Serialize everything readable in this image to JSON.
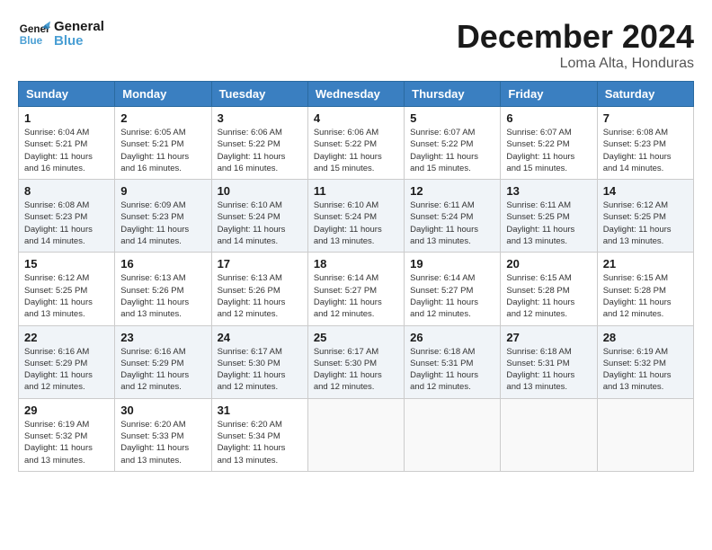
{
  "header": {
    "logo_line1": "General",
    "logo_line2": "Blue",
    "month_title": "December 2024",
    "location": "Loma Alta, Honduras"
  },
  "days_of_week": [
    "Sunday",
    "Monday",
    "Tuesday",
    "Wednesday",
    "Thursday",
    "Friday",
    "Saturday"
  ],
  "weeks": [
    [
      {
        "num": "1",
        "sunrise": "6:04 AM",
        "sunset": "5:21 PM",
        "daylight": "11 hours and 16 minutes."
      },
      {
        "num": "2",
        "sunrise": "6:05 AM",
        "sunset": "5:21 PM",
        "daylight": "11 hours and 16 minutes."
      },
      {
        "num": "3",
        "sunrise": "6:06 AM",
        "sunset": "5:22 PM",
        "daylight": "11 hours and 16 minutes."
      },
      {
        "num": "4",
        "sunrise": "6:06 AM",
        "sunset": "5:22 PM",
        "daylight": "11 hours and 15 minutes."
      },
      {
        "num": "5",
        "sunrise": "6:07 AM",
        "sunset": "5:22 PM",
        "daylight": "11 hours and 15 minutes."
      },
      {
        "num": "6",
        "sunrise": "6:07 AM",
        "sunset": "5:22 PM",
        "daylight": "11 hours and 15 minutes."
      },
      {
        "num": "7",
        "sunrise": "6:08 AM",
        "sunset": "5:23 PM",
        "daylight": "11 hours and 14 minutes."
      }
    ],
    [
      {
        "num": "8",
        "sunrise": "6:08 AM",
        "sunset": "5:23 PM",
        "daylight": "11 hours and 14 minutes."
      },
      {
        "num": "9",
        "sunrise": "6:09 AM",
        "sunset": "5:23 PM",
        "daylight": "11 hours and 14 minutes."
      },
      {
        "num": "10",
        "sunrise": "6:10 AM",
        "sunset": "5:24 PM",
        "daylight": "11 hours and 14 minutes."
      },
      {
        "num": "11",
        "sunrise": "6:10 AM",
        "sunset": "5:24 PM",
        "daylight": "11 hours and 13 minutes."
      },
      {
        "num": "12",
        "sunrise": "6:11 AM",
        "sunset": "5:24 PM",
        "daylight": "11 hours and 13 minutes."
      },
      {
        "num": "13",
        "sunrise": "6:11 AM",
        "sunset": "5:25 PM",
        "daylight": "11 hours and 13 minutes."
      },
      {
        "num": "14",
        "sunrise": "6:12 AM",
        "sunset": "5:25 PM",
        "daylight": "11 hours and 13 minutes."
      }
    ],
    [
      {
        "num": "15",
        "sunrise": "6:12 AM",
        "sunset": "5:25 PM",
        "daylight": "11 hours and 13 minutes."
      },
      {
        "num": "16",
        "sunrise": "6:13 AM",
        "sunset": "5:26 PM",
        "daylight": "11 hours and 13 minutes."
      },
      {
        "num": "17",
        "sunrise": "6:13 AM",
        "sunset": "5:26 PM",
        "daylight": "11 hours and 12 minutes."
      },
      {
        "num": "18",
        "sunrise": "6:14 AM",
        "sunset": "5:27 PM",
        "daylight": "11 hours and 12 minutes."
      },
      {
        "num": "19",
        "sunrise": "6:14 AM",
        "sunset": "5:27 PM",
        "daylight": "11 hours and 12 minutes."
      },
      {
        "num": "20",
        "sunrise": "6:15 AM",
        "sunset": "5:28 PM",
        "daylight": "11 hours and 12 minutes."
      },
      {
        "num": "21",
        "sunrise": "6:15 AM",
        "sunset": "5:28 PM",
        "daylight": "11 hours and 12 minutes."
      }
    ],
    [
      {
        "num": "22",
        "sunrise": "6:16 AM",
        "sunset": "5:29 PM",
        "daylight": "11 hours and 12 minutes."
      },
      {
        "num": "23",
        "sunrise": "6:16 AM",
        "sunset": "5:29 PM",
        "daylight": "11 hours and 12 minutes."
      },
      {
        "num": "24",
        "sunrise": "6:17 AM",
        "sunset": "5:30 PM",
        "daylight": "11 hours and 12 minutes."
      },
      {
        "num": "25",
        "sunrise": "6:17 AM",
        "sunset": "5:30 PM",
        "daylight": "11 hours and 12 minutes."
      },
      {
        "num": "26",
        "sunrise": "6:18 AM",
        "sunset": "5:31 PM",
        "daylight": "11 hours and 12 minutes."
      },
      {
        "num": "27",
        "sunrise": "6:18 AM",
        "sunset": "5:31 PM",
        "daylight": "11 hours and 13 minutes."
      },
      {
        "num": "28",
        "sunrise": "6:19 AM",
        "sunset": "5:32 PM",
        "daylight": "11 hours and 13 minutes."
      }
    ],
    [
      {
        "num": "29",
        "sunrise": "6:19 AM",
        "sunset": "5:32 PM",
        "daylight": "11 hours and 13 minutes."
      },
      {
        "num": "30",
        "sunrise": "6:20 AM",
        "sunset": "5:33 PM",
        "daylight": "11 hours and 13 minutes."
      },
      {
        "num": "31",
        "sunrise": "6:20 AM",
        "sunset": "5:34 PM",
        "daylight": "11 hours and 13 minutes."
      },
      null,
      null,
      null,
      null
    ]
  ]
}
